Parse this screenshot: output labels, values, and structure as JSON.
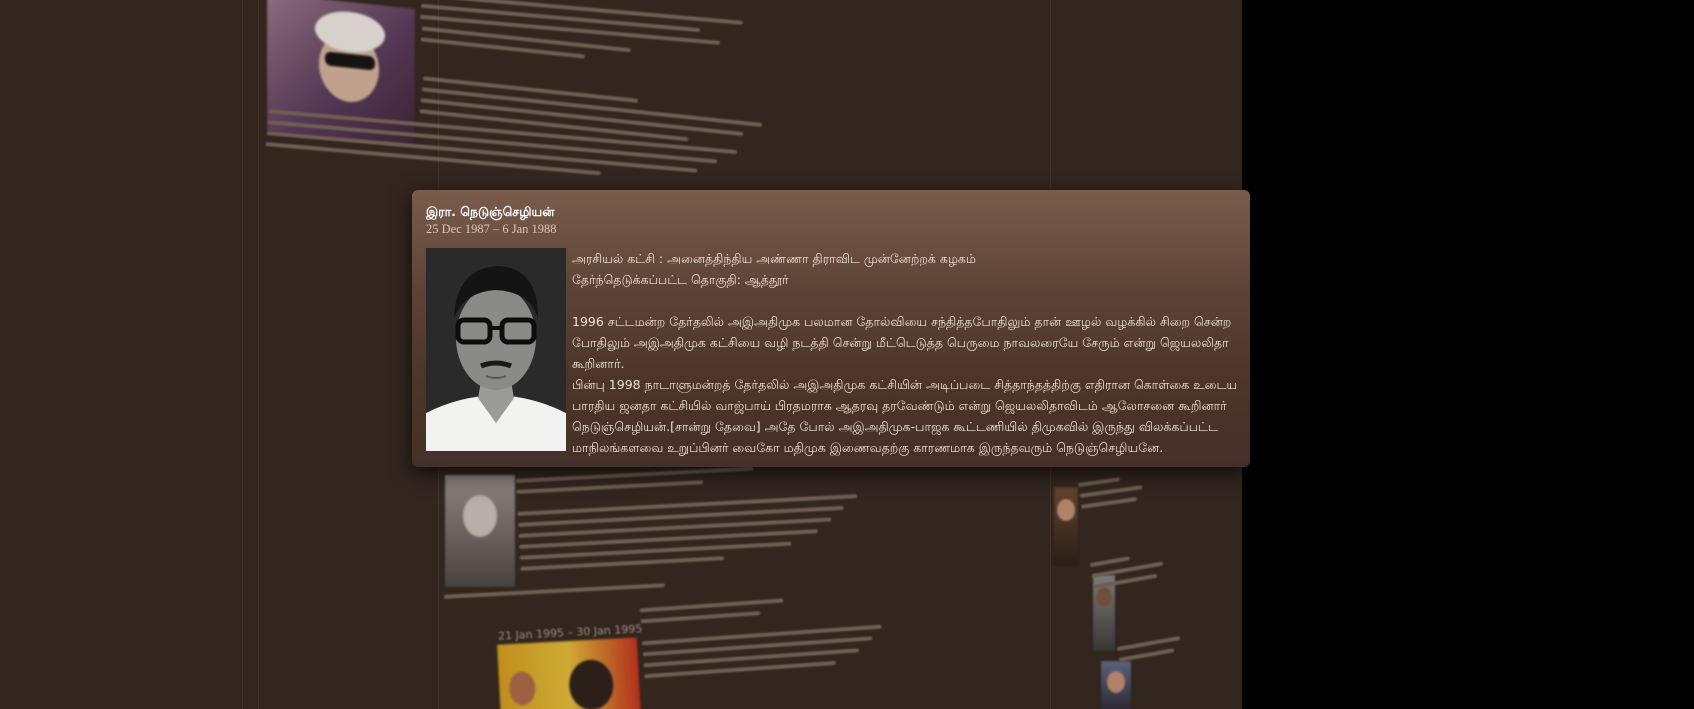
{
  "popup": {
    "name": "இரா. நெடுஞ்செழியன்",
    "dates": "25 Dec 1987 – 6 Jan 1988",
    "party_line": "அரசியல் கட்சி : அனைத்திந்திய அண்ணா திராவிட முன்னேற்றக் கழகம்",
    "constituency_line": "தேர்ந்தெடுக்கப்பட்ட தொகுதி: ஆத்தூர்",
    "bio_lines": [
      "1996 சட்டமன்ற தேர்தலில் அஇஅதிமுக பலமான தோல்வியை சந்தித்தபோதிலும் தான் ஊழல் வழக்கில் சிறை சென்ற",
      "போதிலும் அஇஅதிமுக கட்சியை வழி நடத்தி சென்று மீட்டெடுத்த பெருமை நாவலரையே சேரும் என்று ஜெயலலிதா கூறினார்.",
      "பின்பு 1998 நாடாளுமன்றத் தேர்தலில் அஇஅதிமுக கட்சியின் அடிப்படை சித்தாந்தத்திற்கு எதிரான கொள்கை உடைய",
      "பாரதிய ஜனதா கட்சியில் வாஜ்பாய் பிரதமராக ஆதரவு தரவேண்டும் என்று ஜெயலலிதாவிடம் ஆலோசனை கூறினார்",
      "நெடுஞ்செழியன்.[சான்று தேவை] அதே போல் அஇஅதிமுக-பாஜக கூட்டணியில் திமுகவில் இருந்து விலக்கப்பட்ட",
      "மாநிலங்களவை உறுப்பினர் வைகோ மதிமுக இணைவதற்கு காரணமாக இருந்தவரும் நெடுஞ்செழியனே."
    ]
  },
  "background": {
    "blurred_entries": [
      {
        "date": "21 Jan 1995 – 30 Jan 1995"
      }
    ]
  },
  "colors": {
    "page_bg": "#33261f",
    "outer_bg": "#000000",
    "popup_top": "#7a5c4c",
    "popup_bottom": "#44302a"
  }
}
